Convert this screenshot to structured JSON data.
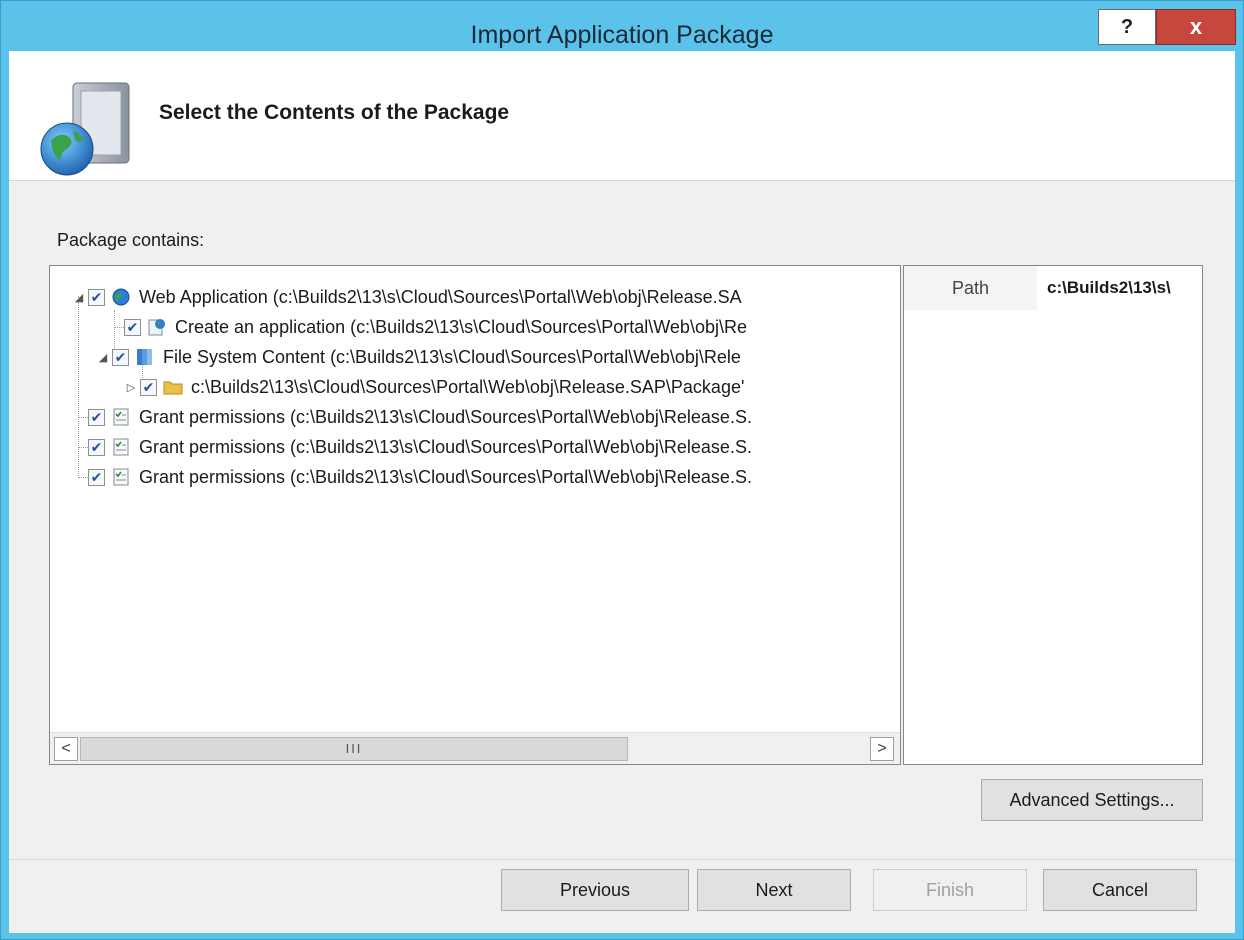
{
  "window": {
    "title": "Import Application Package",
    "help_label": "?",
    "close_label": "x"
  },
  "header": {
    "title": "Select the Contents of the Package",
    "icon": "package-globe-icon"
  },
  "package_label": "Package contains:",
  "tree": [
    {
      "label": "Web Application (c:\\Builds2\\13\\s\\Cloud\\Sources\\Portal\\Web\\obj\\Release.SA",
      "icon": "globe-icon",
      "checked": true,
      "expander": "◢"
    },
    {
      "label": "Create an application (c:\\Builds2\\13\\s\\Cloud\\Sources\\Portal\\Web\\obj\\Re",
      "icon": "application-icon",
      "checked": true,
      "expander": ""
    },
    {
      "label": "File System Content (c:\\Builds2\\13\\s\\Cloud\\Sources\\Portal\\Web\\obj\\Rele",
      "icon": "file-system-icon",
      "checked": true,
      "expander": "◢"
    },
    {
      "label": "c:\\Builds2\\13\\s\\Cloud\\Sources\\Portal\\Web\\obj\\Release.SAP\\Package'",
      "icon": "folder-icon",
      "checked": true,
      "expander": "▷"
    },
    {
      "label": "Grant permissions (c:\\Builds2\\13\\s\\Cloud\\Sources\\Portal\\Web\\obj\\Release.S.",
      "icon": "permissions-icon",
      "checked": true,
      "expander": ""
    },
    {
      "label": "Grant permissions (c:\\Builds2\\13\\s\\Cloud\\Sources\\Portal\\Web\\obj\\Release.S.",
      "icon": "permissions-icon",
      "checked": true,
      "expander": ""
    },
    {
      "label": "Grant permissions (c:\\Builds2\\13\\s\\Cloud\\Sources\\Portal\\Web\\obj\\Release.S.",
      "icon": "permissions-icon",
      "checked": true,
      "expander": ""
    }
  ],
  "scrollbar": {
    "left_arrow": "<",
    "right_arrow": ">",
    "thumb_grip": "III"
  },
  "properties": {
    "name": "Path",
    "value": "c:\\Builds2\\13\\s\\"
  },
  "buttons": {
    "advanced": "Advanced Settings...",
    "previous": "Previous",
    "next": "Next",
    "finish": "Finish",
    "cancel": "Cancel"
  },
  "colors": {
    "titlebar": "#5bc3e9",
    "close": "#c7463d",
    "checkmark": "#2b4ea2"
  }
}
